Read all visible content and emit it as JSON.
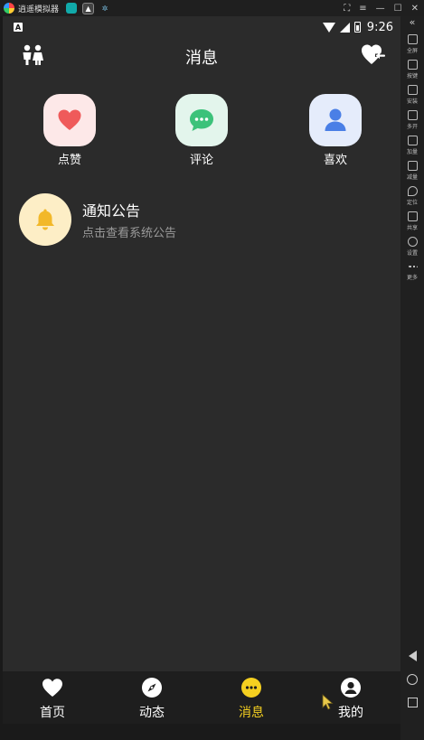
{
  "emulator": {
    "title": "逍遥模拟器",
    "controls": [
      "⛶",
      "≡",
      "—",
      "☐",
      "✕"
    ],
    "side_top": "«",
    "side_items": [
      {
        "label": "全屏",
        "icon": "fullscreen-icon"
      },
      {
        "label": "按键",
        "icon": "keyboard-icon"
      },
      {
        "label": "安装",
        "icon": "apk-install-icon"
      },
      {
        "label": "多开",
        "icon": "multi-instance-icon"
      },
      {
        "label": "加量",
        "icon": "volume-up-icon"
      },
      {
        "label": "减量",
        "icon": "volume-down-icon"
      },
      {
        "label": "定位",
        "icon": "location-icon"
      },
      {
        "label": "共享",
        "icon": "folder-share-icon"
      },
      {
        "label": "设置",
        "icon": "settings-icon"
      },
      {
        "label": "更多",
        "icon": "more-icon"
      }
    ]
  },
  "statusbar": {
    "a_icon": "A",
    "time": "9:26"
  },
  "appbar": {
    "title": "消息"
  },
  "quick": [
    {
      "label": "点赞",
      "icon": "heart-icon",
      "bg": "#fde8e8",
      "color": "#ef5a5a"
    },
    {
      "label": "评论",
      "icon": "chat-bubble-icon",
      "bg": "#e3f5ec",
      "color": "#3cc27a"
    },
    {
      "label": "喜欢",
      "icon": "person-icon",
      "bg": "#e5ecfb",
      "color": "#4a7fe6"
    }
  ],
  "notice": {
    "title": "通知公告",
    "subtitle": "点击查看系统公告",
    "icon_color": "#f2b829"
  },
  "tabs": [
    {
      "label": "首页",
      "icon": "heart-icon",
      "active": false
    },
    {
      "label": "动态",
      "icon": "compass-icon",
      "active": false
    },
    {
      "label": "消息",
      "icon": "message-dots-icon",
      "active": true
    },
    {
      "label": "我的",
      "icon": "profile-icon",
      "active": false
    }
  ],
  "colors": {
    "accent": "#f5d020",
    "background": "#2b2b2b",
    "tabbar": "#1e1e1e"
  }
}
